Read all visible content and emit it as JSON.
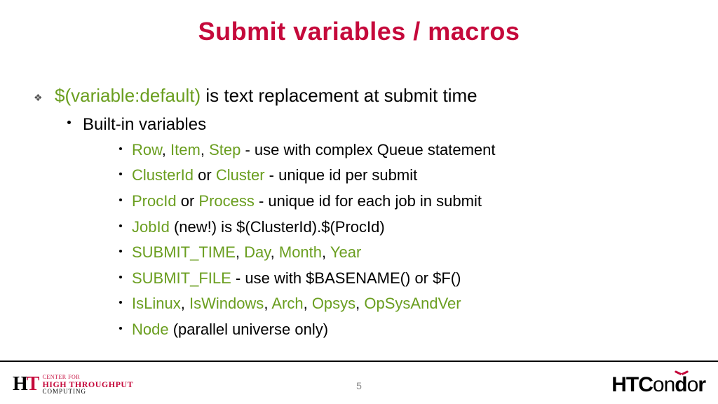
{
  "title": "Submit variables / macros",
  "main": {
    "syntax": "$(variable:default)",
    "syntax_desc": " is text replacement at submit time",
    "sub": "Built-in variables",
    "items": [
      {
        "kws": [
          "Row",
          "Item",
          "Step"
        ],
        "sep": ", ",
        "tail": " - use with complex Queue statement"
      },
      {
        "kws": [
          "ClusterId",
          "Cluster"
        ],
        "sep": " or ",
        "tail": " - unique id per submit"
      },
      {
        "kws": [
          "ProcId",
          "Process"
        ],
        "sep": " or ",
        "tail": " - unique id for each job in submit"
      },
      {
        "kws": [
          "JobId"
        ],
        "sep": "",
        "tail": " (new!) is $(ClusterId).$(ProcId)"
      },
      {
        "kws": [
          "SUBMIT_TIME",
          "Day",
          "Month",
          "Year"
        ],
        "sep": ", ",
        "tail": ""
      },
      {
        "kws": [
          "SUBMIT_FILE"
        ],
        "sep": "",
        "tail": " - use with $BASENAME() or $F()"
      },
      {
        "kws": [
          "IsLinux",
          "IsWindows",
          "Arch",
          "Opsys",
          "OpSysAndVer"
        ],
        "sep": ", ",
        "tail": ""
      },
      {
        "kws": [
          "Node"
        ],
        "sep": "",
        "tail": " (parallel universe only)"
      }
    ]
  },
  "footer": {
    "left": {
      "mark_h": "H",
      "mark_t": "T",
      "l1": "CENTER FOR",
      "l2": "HIGH THROUGHPUT",
      "l3": "COMPUTING"
    },
    "page": "5",
    "right": {
      "bold1": "HTC",
      "thin": "on",
      "bold2": "d",
      "thin2": "o",
      "bold3": "r"
    }
  }
}
